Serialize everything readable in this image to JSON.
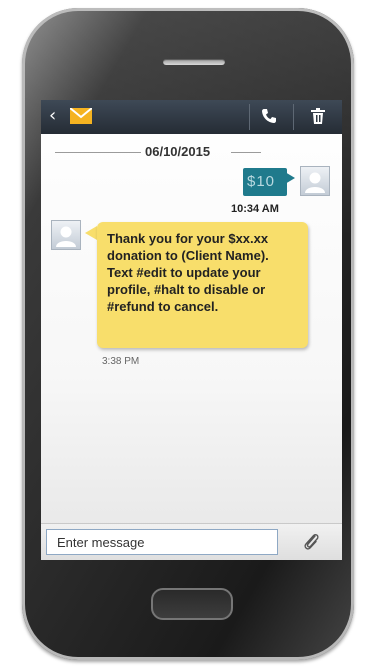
{
  "header": {
    "back_icon": "chevron-left-icon",
    "app_icon": "envelope-icon",
    "call_icon": "phone-icon",
    "delete_icon": "trash-icon"
  },
  "conversation": {
    "date": "06/10/2015",
    "sent_message": {
      "text": "$10",
      "time": "10:34 AM"
    },
    "received_message": {
      "text": "Thank you for your $xx.xx\ndonation to (Client Name).\nText #edit to update your\nprofile, #halt to disable or\n#refund to cancel.",
      "time": "3:38 PM"
    }
  },
  "composer": {
    "placeholder": "Enter message",
    "attach_icon": "paperclip-icon"
  },
  "colors": {
    "topbar": "#2f3843",
    "sent_bubble": "#1f7a8c",
    "received_bubble": "#f8de6b",
    "envelope": "#f5b321"
  }
}
